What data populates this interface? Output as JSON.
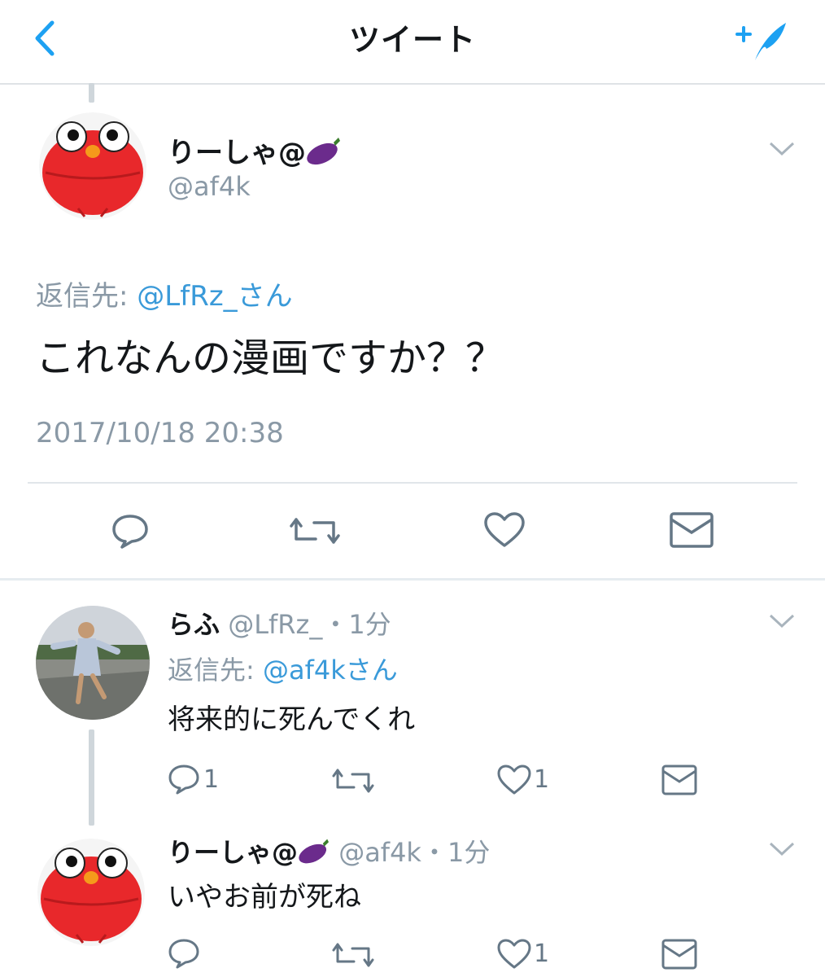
{
  "header": {
    "title": "ツイート"
  },
  "main_tweet": {
    "display_name": "りーしゃ@",
    "display_emoji": "🍆",
    "handle": "@af4k",
    "reply_prefix": "返信先:",
    "reply_to": "@LfRz_さん",
    "text": "これなんの漫画ですか？？",
    "timestamp": "2017/10/18 20:38"
  },
  "replies": [
    {
      "display_name": "らふ",
      "handle_time": "@LfRz_・1分",
      "reply_prefix": "返信先:",
      "reply_to": "@af4kさん",
      "text": "将来的に死んでくれ",
      "reply_count": "1",
      "like_count": "1"
    },
    {
      "display_name": "りーしゃ@",
      "display_emoji": "🍆",
      "handle_time": "@af4k・1分",
      "text": "いやお前が死ね",
      "like_count": "1"
    }
  ],
  "icons": {
    "back": "chevron-left-icon",
    "compose": "compose-tweet-icon",
    "reply": "reply-icon",
    "retweet": "retweet-icon",
    "like": "heart-icon",
    "message": "envelope-icon",
    "menu": "chevron-down-icon",
    "emoji": "eggplant-icon"
  },
  "colors": {
    "accent": "#1da1f2",
    "link": "#3a9ad9",
    "muted": "#8a99a6",
    "avatar_red": "#e8282b"
  }
}
